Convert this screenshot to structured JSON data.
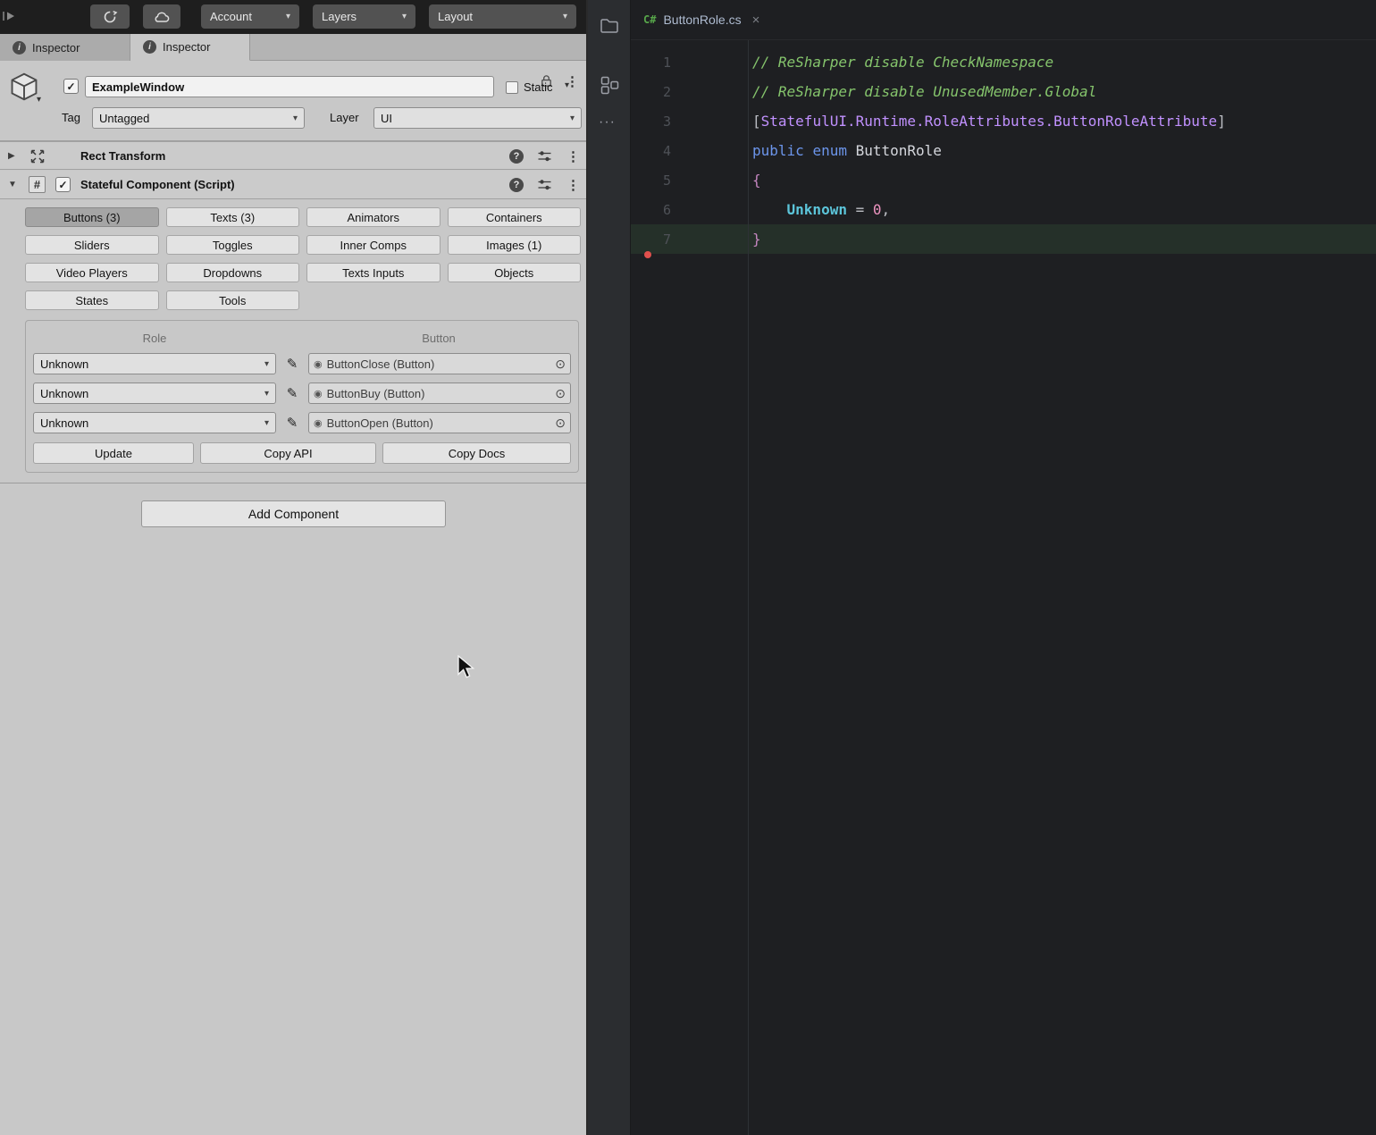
{
  "icons": {
    "info": "i",
    "kebab": "⋮",
    "help": "?",
    "hash": "#",
    "pencil": "✎",
    "object_dot": "◉",
    "object_picker": "⊙",
    "close": "×",
    "more": "···",
    "check": "✓",
    "chevron_down": "▾",
    "foldout_collapsed": "▶",
    "foldout_expanded": "▼"
  },
  "colors": {
    "csharp_icon_green": "#57a64a",
    "comment_green": "#85c46c",
    "attribute_purple": "#c191ff",
    "keyword_blue": "#6c95eb",
    "enum_member_cyan": "#5cc5da",
    "error_marker_red": "#e0504d"
  },
  "unity": {
    "toolbar": {
      "account_label": "Account",
      "layers_label": "Layers",
      "layout_label": "Layout"
    },
    "tabs": [
      {
        "label": "Inspector"
      },
      {
        "label": "Inspector"
      }
    ],
    "gameobject": {
      "name_value": "ExampleWindow",
      "static_label": "Static",
      "tag_label": "Tag",
      "tag_value": "Untagged",
      "layer_label": "Layer",
      "layer_value": "UI"
    },
    "rect_transform": {
      "title": "Rect Transform"
    },
    "stateful_component": {
      "title": "Stateful Component (Script)",
      "categories": [
        {
          "label": "Buttons (3)",
          "selected": true
        },
        {
          "label": "Texts (3)",
          "selected": false
        },
        {
          "label": "Animators",
          "selected": false
        },
        {
          "label": "Containers",
          "selected": false
        },
        {
          "label": "Sliders",
          "selected": false
        },
        {
          "label": "Toggles",
          "selected": false
        },
        {
          "label": "Inner Comps",
          "selected": false
        },
        {
          "label": "Images (1)",
          "selected": false
        },
        {
          "label": "Video Players",
          "selected": false
        },
        {
          "label": "Dropdowns",
          "selected": false
        },
        {
          "label": "Texts Inputs",
          "selected": false
        },
        {
          "label": "Objects",
          "selected": false
        },
        {
          "label": "States",
          "selected": false
        },
        {
          "label": "Tools",
          "selected": false
        }
      ],
      "role_table": {
        "role_header": "Role",
        "button_header": "Button",
        "rows": [
          {
            "role": "Unknown",
            "target": "ButtonClose (Button)"
          },
          {
            "role": "Unknown",
            "target": "ButtonBuy (Button)"
          },
          {
            "role": "Unknown",
            "target": "ButtonOpen (Button)"
          }
        ],
        "actions": [
          "Update",
          "Copy API",
          "Copy Docs"
        ]
      }
    },
    "add_component_label": "Add Component"
  },
  "code_editor": {
    "tab": {
      "language": "C#",
      "filename": "ButtonRole.cs"
    },
    "lines": [
      {
        "num": "1",
        "highlight": false,
        "tokens": [
          {
            "t": "// ReSharper disable CheckNamespace",
            "c": "comment"
          }
        ]
      },
      {
        "num": "2",
        "highlight": false,
        "tokens": [
          {
            "t": "// ReSharper disable UnusedMember.Global",
            "c": "comment"
          }
        ]
      },
      {
        "num": "3",
        "highlight": false,
        "tokens": [
          {
            "t": "[",
            "c": "plain"
          },
          {
            "t": "StatefulUI.Runtime.RoleAttributes.ButtonRoleAttribute",
            "c": "attr"
          },
          {
            "t": "]",
            "c": "plain"
          }
        ]
      },
      {
        "num": "4",
        "highlight": false,
        "tokens": [
          {
            "t": "public",
            "c": "kw"
          },
          {
            "t": " ",
            "c": "plain"
          },
          {
            "t": "enum",
            "c": "kw"
          },
          {
            "t": " ",
            "c": "plain"
          },
          {
            "t": "ButtonRole",
            "c": "type"
          }
        ]
      },
      {
        "num": "5",
        "highlight": false,
        "tokens": [
          {
            "t": "{",
            "c": "brace"
          }
        ]
      },
      {
        "num": "6",
        "highlight": false,
        "tokens": [
          {
            "t": "    ",
            "c": "plain"
          },
          {
            "t": "Unknown",
            "c": "enum"
          },
          {
            "t": " = ",
            "c": "plain"
          },
          {
            "t": "0",
            "c": "num"
          },
          {
            "t": ",",
            "c": "plain"
          }
        ]
      },
      {
        "num": "7",
        "highlight": true,
        "tokens": [
          {
            "t": "}",
            "c": "brace"
          }
        ]
      }
    ]
  }
}
